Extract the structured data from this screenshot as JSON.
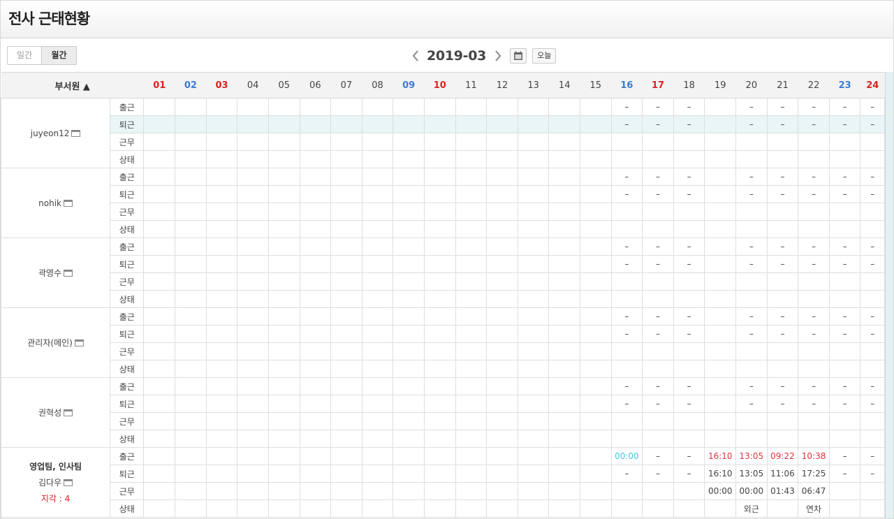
{
  "title": "전사 근태현황",
  "toggle": {
    "daily": "일간",
    "monthly": "월간"
  },
  "nav": {
    "month": "2019-03",
    "prev_icon": "chevron-left-icon",
    "next_icon": "chevron-right-icon",
    "calendar_icon": "calendar-icon",
    "today": "오늘"
  },
  "table": {
    "member_header": "부서원 ▲",
    "days": [
      {
        "d": "01",
        "t": "sun"
      },
      {
        "d": "02",
        "t": "sat"
      },
      {
        "d": "03",
        "t": "sun"
      },
      {
        "d": "04",
        "t": ""
      },
      {
        "d": "05",
        "t": ""
      },
      {
        "d": "06",
        "t": ""
      },
      {
        "d": "07",
        "t": ""
      },
      {
        "d": "08",
        "t": ""
      },
      {
        "d": "09",
        "t": "sat"
      },
      {
        "d": "10",
        "t": "sun"
      },
      {
        "d": "11",
        "t": ""
      },
      {
        "d": "12",
        "t": ""
      },
      {
        "d": "13",
        "t": ""
      },
      {
        "d": "14",
        "t": ""
      },
      {
        "d": "15",
        "t": ""
      },
      {
        "d": "16",
        "t": "sat"
      },
      {
        "d": "17",
        "t": "sun"
      },
      {
        "d": "18",
        "t": ""
      },
      {
        "d": "19",
        "t": ""
      },
      {
        "d": "20",
        "t": ""
      },
      {
        "d": "21",
        "t": ""
      },
      {
        "d": "22",
        "t": ""
      },
      {
        "d": "23",
        "t": "sat"
      },
      {
        "d": "24",
        "t": "sun"
      }
    ],
    "row_labels": [
      "출근",
      "퇴근",
      "근무",
      "상태"
    ],
    "members": [
      {
        "name": "juyeon12",
        "dept": "",
        "late": "",
        "rows": [
          [
            "",
            "",
            "",
            "",
            "",
            "",
            "",
            "",
            "",
            "",
            "",
            "",
            "",
            "",
            "",
            "–",
            "–",
            "–",
            "",
            "–",
            "–",
            "–",
            "–",
            "–"
          ],
          [
            "",
            "",
            "",
            "",
            "",
            "",
            "",
            "",
            "",
            "",
            "",
            "",
            "",
            "",
            "",
            "–",
            "–",
            "–",
            "",
            "–",
            "–",
            "–",
            "–",
            "–"
          ],
          [
            "",
            "",
            "",
            "",
            "",
            "",
            "",
            "",
            "",
            "",
            "",
            "",
            "",
            "",
            "",
            "",
            "",
            "",
            "",
            "",
            "",
            "",
            "",
            ""
          ],
          [
            "",
            "",
            "",
            "",
            "",
            "",
            "",
            "",
            "",
            "",
            "",
            "",
            "",
            "",
            "",
            "",
            "",
            "",
            "",
            "",
            "",
            "",
            "",
            ""
          ]
        ]
      },
      {
        "name": "nohik",
        "dept": "",
        "late": "",
        "rows": [
          [
            "",
            "",
            "",
            "",
            "",
            "",
            "",
            "",
            "",
            "",
            "",
            "",
            "",
            "",
            "",
            "–",
            "–",
            "–",
            "",
            "–",
            "–",
            "–",
            "–",
            "–"
          ],
          [
            "",
            "",
            "",
            "",
            "",
            "",
            "",
            "",
            "",
            "",
            "",
            "",
            "",
            "",
            "",
            "–",
            "–",
            "–",
            "",
            "–",
            "–",
            "–",
            "–",
            "–"
          ],
          [
            "",
            "",
            "",
            "",
            "",
            "",
            "",
            "",
            "",
            "",
            "",
            "",
            "",
            "",
            "",
            "",
            "",
            "",
            "",
            "",
            "",
            "",
            "",
            ""
          ],
          [
            "",
            "",
            "",
            "",
            "",
            "",
            "",
            "",
            "",
            "",
            "",
            "",
            "",
            "",
            "",
            "",
            "",
            "",
            "",
            "",
            "",
            "",
            "",
            ""
          ]
        ]
      },
      {
        "name": "곽영수",
        "dept": "",
        "late": "",
        "rows": [
          [
            "",
            "",
            "",
            "",
            "",
            "",
            "",
            "",
            "",
            "",
            "",
            "",
            "",
            "",
            "",
            "–",
            "–",
            "–",
            "",
            "–",
            "–",
            "–",
            "–",
            "–"
          ],
          [
            "",
            "",
            "",
            "",
            "",
            "",
            "",
            "",
            "",
            "",
            "",
            "",
            "",
            "",
            "",
            "–",
            "–",
            "–",
            "",
            "–",
            "–",
            "–",
            "–",
            "–"
          ],
          [
            "",
            "",
            "",
            "",
            "",
            "",
            "",
            "",
            "",
            "",
            "",
            "",
            "",
            "",
            "",
            "",
            "",
            "",
            "",
            "",
            "",
            "",
            "",
            ""
          ],
          [
            "",
            "",
            "",
            "",
            "",
            "",
            "",
            "",
            "",
            "",
            "",
            "",
            "",
            "",
            "",
            "",
            "",
            "",
            "",
            "",
            "",
            "",
            "",
            ""
          ]
        ]
      },
      {
        "name": "관리자(메인)",
        "dept": "",
        "late": "",
        "rows": [
          [
            "",
            "",
            "",
            "",
            "",
            "",
            "",
            "",
            "",
            "",
            "",
            "",
            "",
            "",
            "",
            "–",
            "–",
            "–",
            "",
            "–",
            "–",
            "–",
            "–",
            "–"
          ],
          [
            "",
            "",
            "",
            "",
            "",
            "",
            "",
            "",
            "",
            "",
            "",
            "",
            "",
            "",
            "",
            "–",
            "–",
            "–",
            "",
            "–",
            "–",
            "–",
            "–",
            "–"
          ],
          [
            "",
            "",
            "",
            "",
            "",
            "",
            "",
            "",
            "",
            "",
            "",
            "",
            "",
            "",
            "",
            "",
            "",
            "",
            "",
            "",
            "",
            "",
            "",
            ""
          ],
          [
            "",
            "",
            "",
            "",
            "",
            "",
            "",
            "",
            "",
            "",
            "",
            "",
            "",
            "",
            "",
            "",
            "",
            "",
            "",
            "",
            "",
            "",
            "",
            ""
          ]
        ]
      },
      {
        "name": "권혁성",
        "dept": "",
        "late": "",
        "rows": [
          [
            "",
            "",
            "",
            "",
            "",
            "",
            "",
            "",
            "",
            "",
            "",
            "",
            "",
            "",
            "",
            "–",
            "–",
            "–",
            "",
            "–",
            "–",
            "–",
            "–",
            "–"
          ],
          [
            "",
            "",
            "",
            "",
            "",
            "",
            "",
            "",
            "",
            "",
            "",
            "",
            "",
            "",
            "",
            "–",
            "–",
            "–",
            "",
            "–",
            "–",
            "–",
            "–",
            "–"
          ],
          [
            "",
            "",
            "",
            "",
            "",
            "",
            "",
            "",
            "",
            "",
            "",
            "",
            "",
            "",
            "",
            "",
            "",
            "",
            "",
            "",
            "",
            "",
            "",
            ""
          ],
          [
            "",
            "",
            "",
            "",
            "",
            "",
            "",
            "",
            "",
            "",
            "",
            "",
            "",
            "",
            "",
            "",
            "",
            "",
            "",
            "",
            "",
            "",
            "",
            ""
          ]
        ]
      },
      {
        "name": "김다우",
        "dept": "영업팀, 인사팀",
        "late": "지각 : 4",
        "rows": [
          [
            "",
            "",
            "",
            "",
            "",
            "",
            "",
            "",
            "",
            "",
            "",
            "",
            "",
            "",
            "",
            "00:00",
            "–",
            "–",
            "16:10",
            "13:05",
            "09:22",
            "10:38",
            "–",
            "–"
          ],
          [
            "",
            "",
            "",
            "",
            "",
            "",
            "",
            "",
            "",
            "",
            "",
            "",
            "",
            "",
            "",
            "–",
            "–",
            "–",
            "16:10",
            "13:05",
            "11:06",
            "17:25",
            "–",
            "–"
          ],
          [
            "",
            "",
            "",
            "",
            "",
            "",
            "",
            "",
            "",
            "",
            "",
            "",
            "",
            "",
            "",
            "",
            "",
            "",
            "00:00",
            "00:00",
            "01:43",
            "06:47",
            "",
            ""
          ],
          [
            "",
            "",
            "",
            "",
            "",
            "",
            "",
            "",
            "",
            "",
            "",
            "",
            "",
            "",
            "",
            "",
            "",
            "",
            "",
            "외근",
            "",
            "연차",
            "",
            ""
          ]
        ]
      }
    ],
    "special": {
      "cyan": [
        "5-0-15"
      ],
      "red": [
        "5-0-18",
        "5-0-19",
        "5-0-20",
        "5-0-21"
      ]
    },
    "highlight_row": "0-1"
  }
}
